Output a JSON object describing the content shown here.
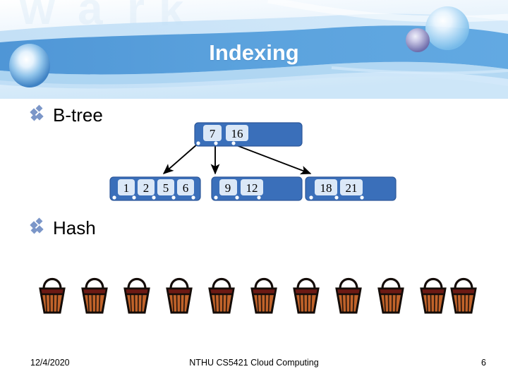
{
  "slide": {
    "title": "Indexing",
    "background_color": "#ffffff",
    "banner_blue": "#5b9bd5",
    "banner_light_blue": "#aed3ef"
  },
  "bullets": [
    {
      "marker": "diamond-cluster-bullet",
      "label": "B-tree"
    },
    {
      "marker": "diamond-cluster-bullet",
      "label": "Hash"
    }
  ],
  "btree": {
    "node_fill": "#3a6fba",
    "node_stroke": "#2d589a",
    "key_fill": "#dbe8f7",
    "key_text_color": "#000000",
    "pointer_dot_color": "#ffffff",
    "arrow_color": "#000000",
    "root": {
      "keys": [
        "7",
        "16"
      ],
      "pointer_count": 3
    },
    "leaves": [
      {
        "keys": [
          "1",
          "2",
          "5",
          "6"
        ],
        "pointer_count": 5
      },
      {
        "keys": [
          "9",
          "12"
        ],
        "pointer_count": 3
      },
      {
        "keys": [
          "18",
          "21"
        ],
        "pointer_count": 3
      }
    ]
  },
  "hash": {
    "icon_name": "basket-bucket-icon",
    "bucket_count": 11,
    "bucket_body_color": "#c1632a",
    "bucket_rim_color": "#6b1a14",
    "bucket_outline_color": "#140c08",
    "bucket_positions": [
      47,
      107,
      167,
      227,
      287,
      347,
      407,
      467,
      527,
      587,
      630
    ]
  },
  "footer": {
    "date": "12/4/2020",
    "center": "NTHU CS5421 Cloud Computing",
    "page_number": "6"
  }
}
